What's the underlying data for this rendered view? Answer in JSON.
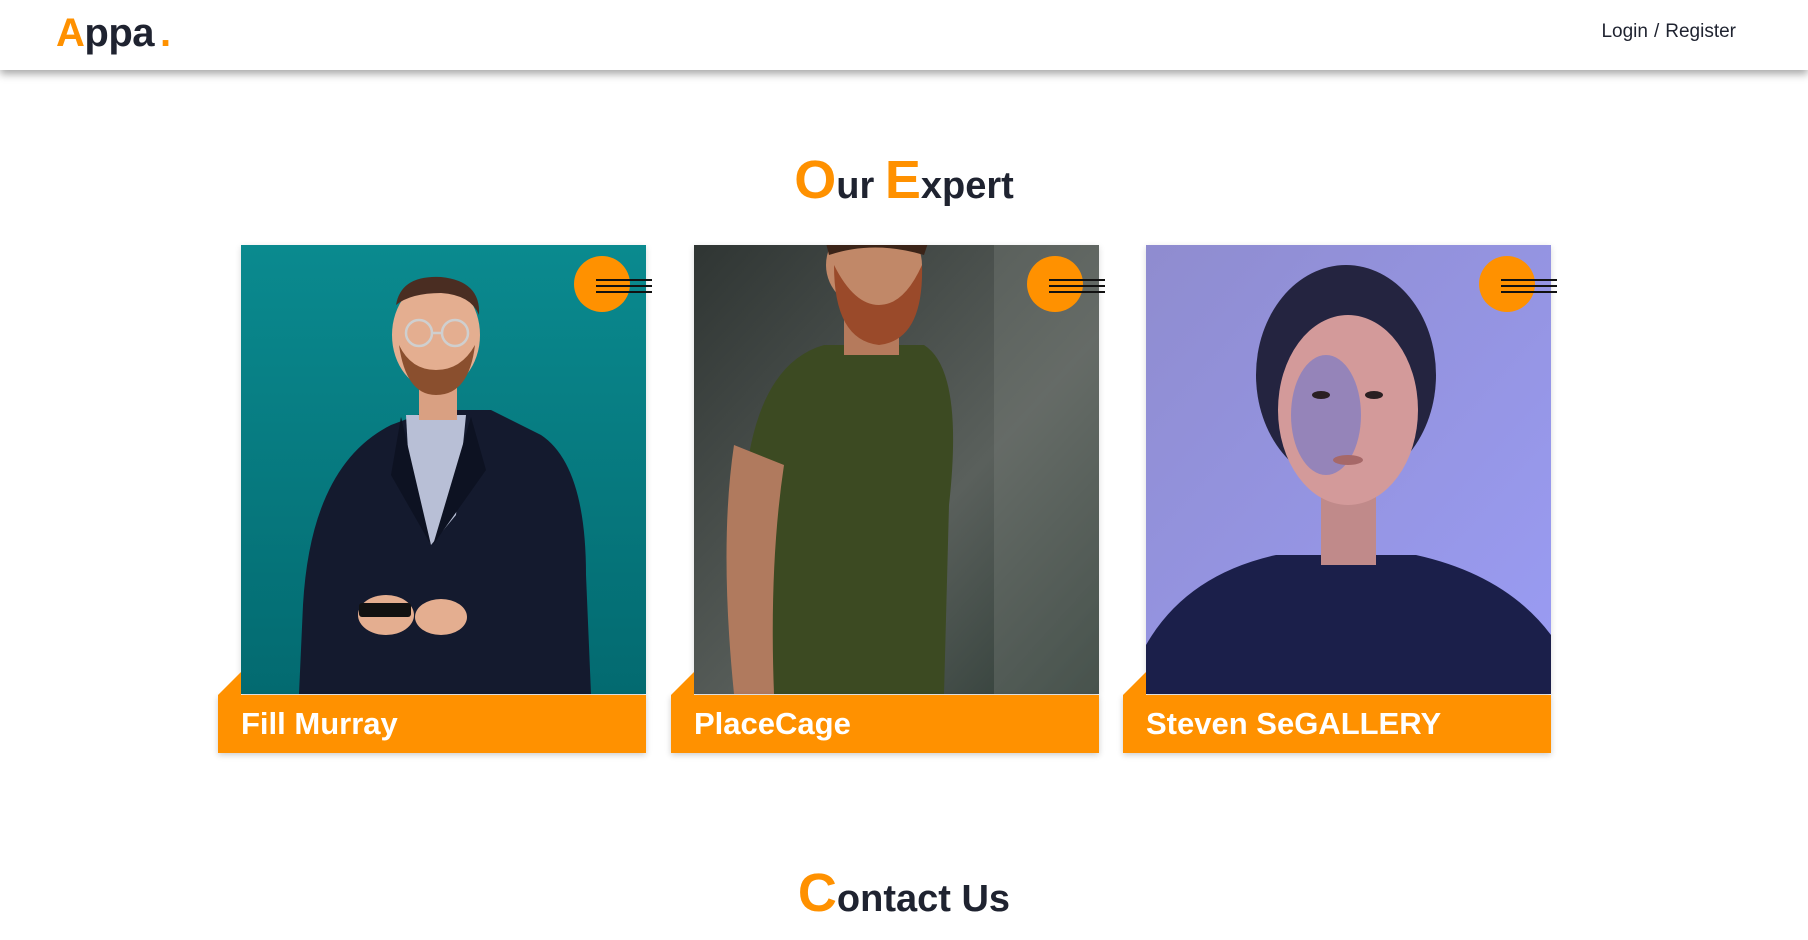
{
  "header": {
    "logo": {
      "first_letter": "A",
      "rest": "ppa",
      "dot": "."
    },
    "auth": {
      "login": "Login",
      "separator": "/",
      "register": "Register"
    }
  },
  "experts_section": {
    "title_big_1": "O",
    "title_rest_1": "ur ",
    "title_big_2": "E",
    "title_rest_2": "xpert",
    "cards": [
      {
        "name": "Fill Murray",
        "photo": "man-in-suit-teal-background",
        "menu_icon": "hamburger-icon"
      },
      {
        "name": "PlaceCage",
        "photo": "bearded-man-green-shirt",
        "menu_icon": "hamburger-icon"
      },
      {
        "name": "Steven SeGALLERY",
        "photo": "woman-purple-lighting",
        "menu_icon": "hamburger-icon"
      }
    ]
  },
  "contact_section": {
    "title_big": "C",
    "title_rest": "ontact Us"
  },
  "colors": {
    "accent": "#ff9100",
    "text": "#1f2330",
    "background": "#ffffff"
  }
}
